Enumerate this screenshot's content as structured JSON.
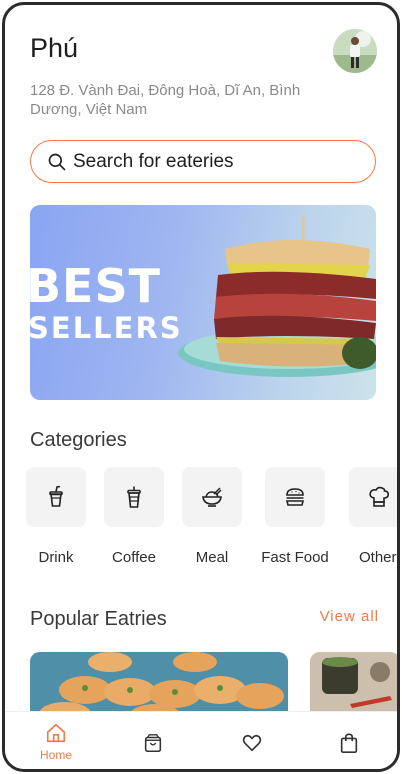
{
  "header": {
    "user_name": "Phú",
    "address": "128 Đ. Vành Đai, Đông Hoà, Dĩ An, Bình Dương, Việt Nam"
  },
  "search": {
    "placeholder": "Search for eateries"
  },
  "banner": {
    "line1": "BEST",
    "line2": "SELLERS"
  },
  "categories": {
    "title": "Categories",
    "items": [
      {
        "label": "Drink",
        "icon": "drink-icon"
      },
      {
        "label": "Coffee",
        "icon": "coffee-icon"
      },
      {
        "label": "Meal",
        "icon": "meal-icon"
      },
      {
        "label": "Fast Food",
        "icon": "burger-icon"
      },
      {
        "label": "Other",
        "icon": "chef-hat-icon"
      }
    ]
  },
  "popular": {
    "title": "Popular Eatries",
    "view_all": "View all"
  },
  "bottom_nav": {
    "items": [
      {
        "label": "Home",
        "icon": "home-icon",
        "active": true
      },
      {
        "label": "",
        "icon": "shopping-bag-icon"
      },
      {
        "label": "",
        "icon": "heart-icon"
      },
      {
        "label": "",
        "icon": "bag-icon"
      }
    ]
  },
  "colors": {
    "accent": "#ef7b4a",
    "text": "#1f1f1f",
    "muted": "#8a8a8a"
  }
}
